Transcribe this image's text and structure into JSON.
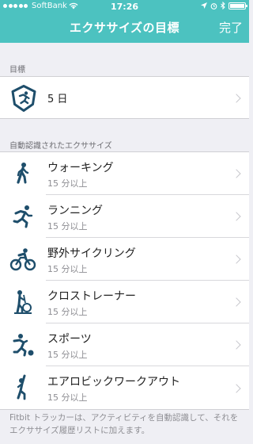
{
  "status_bar": {
    "carrier": "SoftBank",
    "time": "17:26"
  },
  "nav": {
    "title": "エクササイズの目標",
    "done_label": "完了"
  },
  "goal_section": {
    "header": "目標",
    "value": "5 日"
  },
  "auto_section": {
    "header": "自動認識されたエクササイズ",
    "items": [
      {
        "title": "ウォーキング",
        "subtitle": "15 分以上",
        "icon": "walking-icon"
      },
      {
        "title": "ランニング",
        "subtitle": "15 分以上",
        "icon": "running-icon"
      },
      {
        "title": "野外サイクリング",
        "subtitle": "15 分以上",
        "icon": "cycling-icon"
      },
      {
        "title": "クロストレーナー",
        "subtitle": "15 分以上",
        "icon": "elliptical-icon"
      },
      {
        "title": "スポーツ",
        "subtitle": "15 分以上",
        "icon": "sports-icon"
      },
      {
        "title": "エアロビックワークアウト",
        "subtitle": "15 分以上",
        "icon": "aerobic-icon"
      }
    ]
  },
  "footer": {
    "note": "Fitbit トラッカーは、アクティビティを自動認識して、それをエクササイズ履歴リストに加えます。"
  },
  "colors": {
    "accent": "#4cc2c0",
    "icon": "#1e4e6b"
  }
}
